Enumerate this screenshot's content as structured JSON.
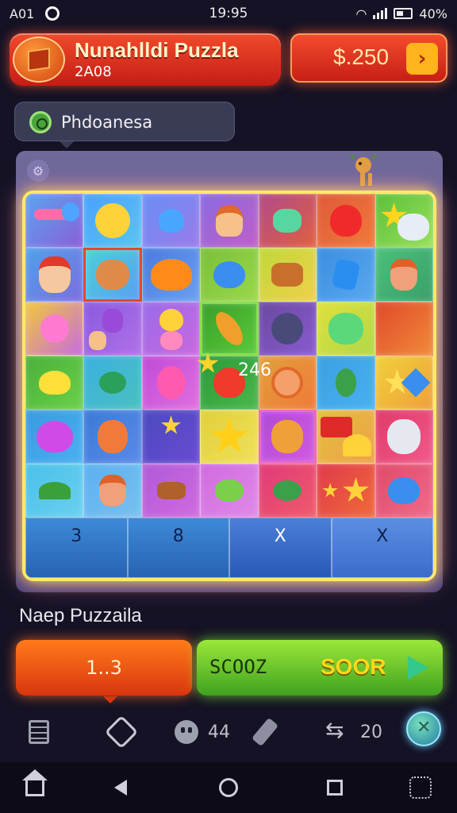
{
  "status_bar": {
    "carrier": "A01",
    "time": "19:95",
    "battery": "40%"
  },
  "header": {
    "title": "Nunahlldi Puzzla",
    "subtitle": "2A08",
    "price": "$.250"
  },
  "category": {
    "label": "Phdoanesa"
  },
  "board": {
    "bottom_slots": [
      "3",
      "8",
      "X",
      "X"
    ],
    "slot_score": "246"
  },
  "level": {
    "name": "Naep Puzzaila"
  },
  "actions": {
    "left_label": "1..3",
    "right_code": "SCOOZ",
    "right_label": "SOOR"
  },
  "toolbar": {
    "count_a": "44",
    "count_b": "20"
  },
  "colors": {
    "header_red": "#d8261a",
    "action_orange": "#ff7a1a",
    "action_green": "#3fa21f",
    "board_glow": "#ffe86a",
    "background": "#141224"
  }
}
